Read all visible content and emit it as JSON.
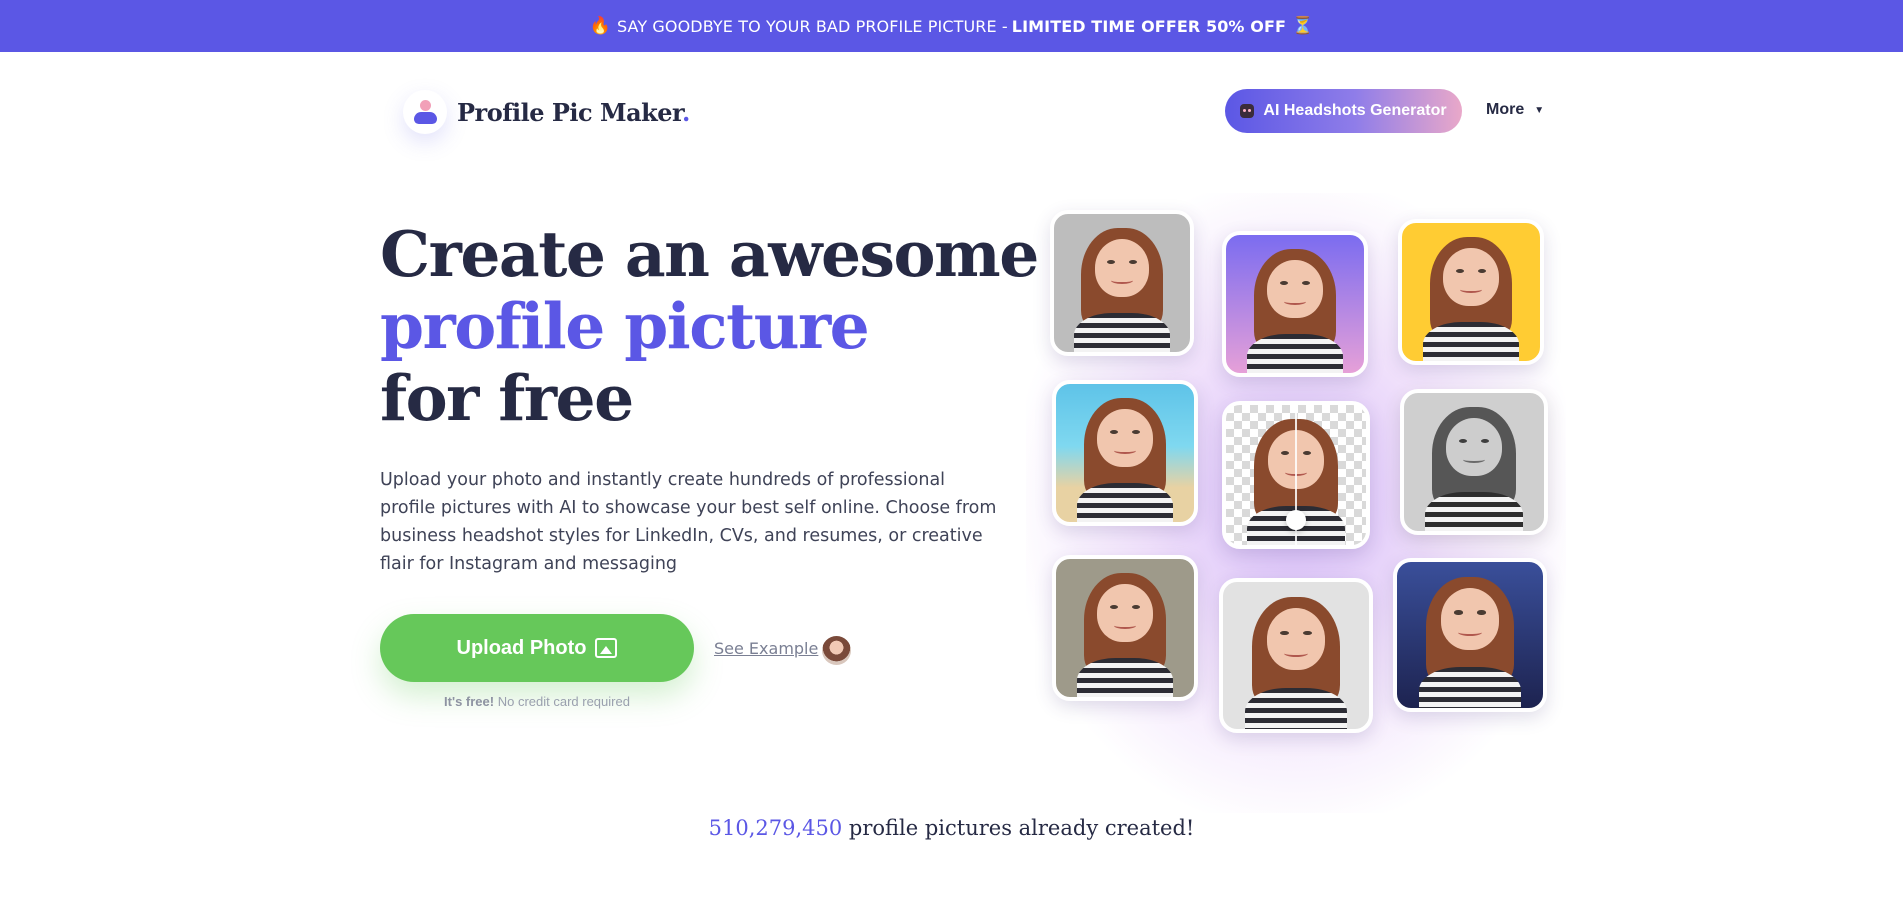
{
  "promo": {
    "fire_icon": "🔥",
    "text": "SAY GOODBYE TO YOUR BAD PROFILE PICTURE -",
    "offer": "LIMITED TIME OFFER 50% OFF",
    "hourglass_icon": "⏳"
  },
  "header": {
    "logo_text": "Profile Pic Maker",
    "logo_dot": ".",
    "ai_button_label": "AI Headshots Generator",
    "more_label": "More",
    "more_caret": "▼"
  },
  "hero": {
    "title_line1": "Create an awesome",
    "title_line2": "profile picture",
    "title_line3": "for free",
    "description": "Upload your photo and instantly create hundreds of professional profile pictures with AI to showcase your best self online. Choose from business headshot styles for LinkedIn, CVs, and resumes, or creative flair for Instagram and messaging",
    "upload_label": "Upload Photo",
    "see_example_label": "See Example",
    "free_bold": "It's free!",
    "free_rest": "No credit card required"
  },
  "counter": {
    "number": "510,279,450",
    "text": "profile pictures already created!"
  },
  "colors": {
    "brand": "#5b57e5",
    "cta_green": "#66c85a",
    "text_dark": "#262a44"
  },
  "gallery": [
    {
      "name": "gray",
      "bg": "#bdbdbd",
      "grayscale": false
    },
    {
      "name": "purple-pink",
      "bg": "linear-gradient(180deg,#7b6cf0,#e6a0d8)",
      "grayscale": false
    },
    {
      "name": "yellow",
      "bg": "#ffcc33",
      "grayscale": false
    },
    {
      "name": "beach",
      "bg": "linear-gradient(180deg,#5ec3e8 0%,#7fd8f0 45%,#e8d2a3 75%)",
      "grayscale": false
    },
    {
      "name": "transparent-compare",
      "bg": "repeating-conic-gradient(#d9d9d9 0% 25%, #ffffff 0% 50%) 0 0/16px 16px",
      "grayscale": false
    },
    {
      "name": "black-white",
      "bg": "#cfcfcf",
      "grayscale": true
    },
    {
      "name": "portrait-neutral",
      "bg": "#9e9a8a",
      "grayscale": false
    },
    {
      "name": "business-suit",
      "bg": "#e2e2e2",
      "grayscale": false
    },
    {
      "name": "astronaut",
      "bg": "linear-gradient(180deg,#3a4f9a,#1d2350)",
      "grayscale": false
    }
  ]
}
